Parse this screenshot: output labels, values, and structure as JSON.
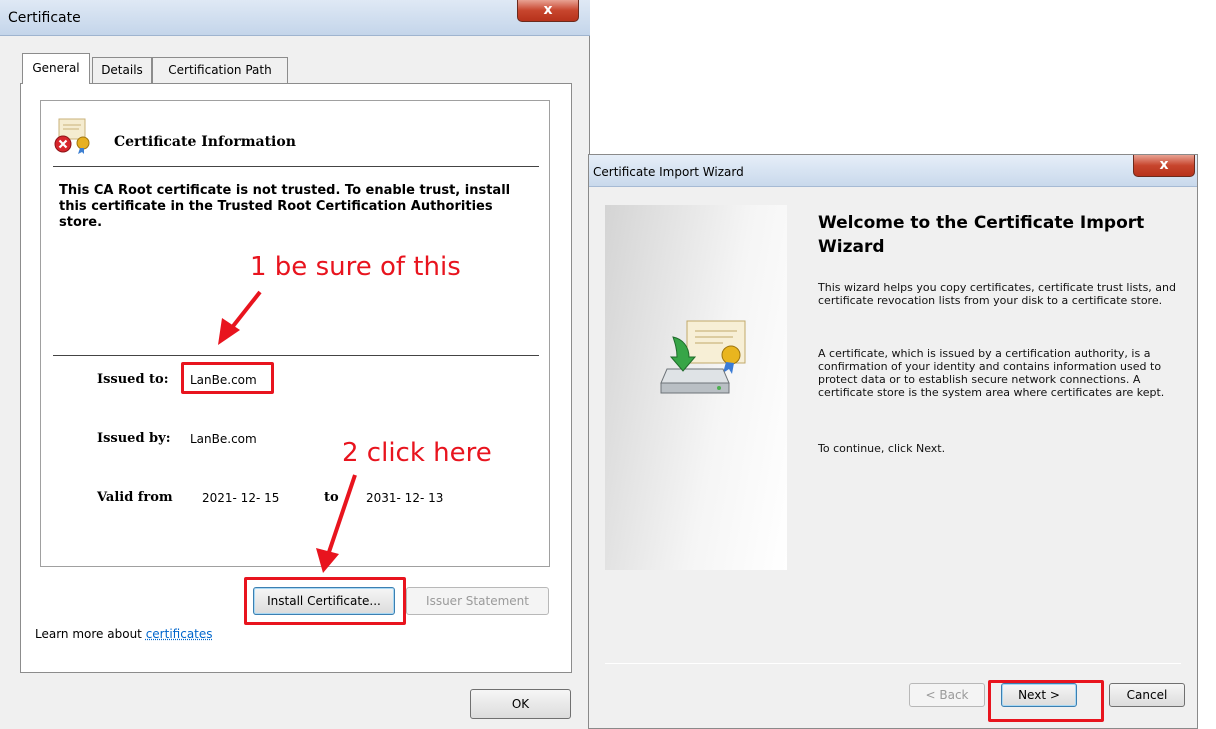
{
  "certificate_window": {
    "title": "Certificate",
    "close_label": "x",
    "tabs": [
      {
        "label": "General"
      },
      {
        "label": "Details"
      },
      {
        "label": "Certification Path"
      }
    ],
    "info_heading": "Certificate Information",
    "trust_message": "This CA Root certificate is not trusted. To enable trust, install this certificate in the Trusted Root Certification Authorities store.",
    "issued_to_label": "Issued to:",
    "issued_to_value": "LanBe.com",
    "issued_by_label": "Issued by:",
    "issued_by_value": "LanBe.com",
    "valid_from_label": "Valid from",
    "valid_from_value": "2021- 12- 15",
    "to_label": "to",
    "valid_to_value": "2031- 12- 13",
    "install_button": "Install Certificate...",
    "issuer_statement_button": "Issuer Statement",
    "learn_more_prefix": "Learn more about ",
    "learn_more_link": "certificates",
    "ok_button": "OK"
  },
  "wizard_window": {
    "title": "Certificate Import Wizard",
    "close_label": "x",
    "heading": "Welcome to the Certificate Import Wizard",
    "paragraph1": "This wizard helps you copy certificates, certificate trust lists, and certificate revocation lists from your disk to a certificate store.",
    "paragraph2": "A certificate, which is issued by a certification authority, is a confirmation of your identity and contains information used to protect data or to establish secure network connections. A certificate store is the system area where certificates are kept.",
    "paragraph3": "To continue, click Next.",
    "back_button": "< Back",
    "next_button": "Next >",
    "cancel_button": "Cancel"
  },
  "annotations": {
    "note1": "1 be sure of this",
    "note2": "2 click here",
    "color": "#e8141e"
  },
  "icons": [
    "certificate-error-icon",
    "certificate-import-icon",
    "arrow-annotation-icon"
  ]
}
